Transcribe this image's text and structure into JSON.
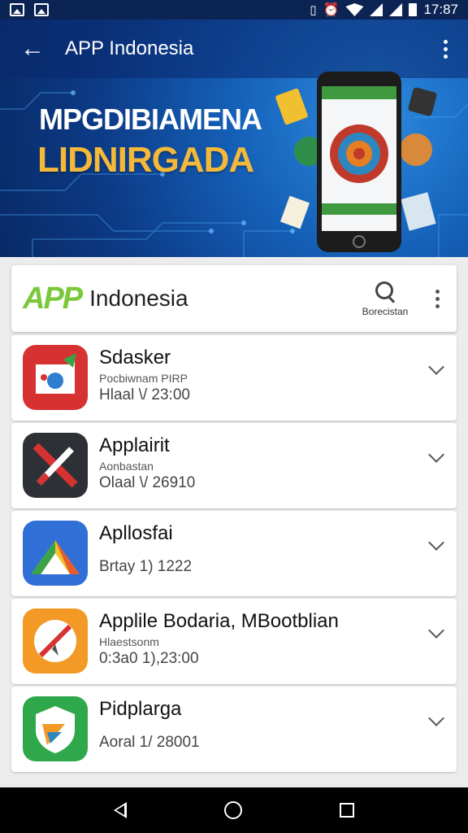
{
  "status_bar": {
    "time": "17:87"
  },
  "app_bar": {
    "title": "APP Indonesia"
  },
  "hero": {
    "line1": "MPGDIBIAMENA",
    "line2": "LIDNIRGADA"
  },
  "header": {
    "logo_mark": "APP",
    "logo_name": "Indonesia",
    "search_label": "Borecistan"
  },
  "list": {
    "items": [
      {
        "title": "Sdasker",
        "subtitle": "Pocbiwnam PIRP",
        "meta": "Hlaal \\/ 23:00",
        "icon": "red-chat-icon"
      },
      {
        "title": "Applairit",
        "subtitle": "Aonbastan",
        "meta": "Olaal \\/ 26910",
        "icon": "dark-x-icon"
      },
      {
        "title": "Apllosfai",
        "subtitle": "",
        "meta": "Brtay 1) 1222",
        "icon": "blue-triangle-icon"
      },
      {
        "title": "Applile Bodaria, MBootblian",
        "subtitle": "Hlaestsonm",
        "meta": "0:3a0 1),23:00",
        "icon": "orange-compass-icon"
      },
      {
        "title": "Pidplarga",
        "subtitle": "",
        "meta": "Aoral 1/ 28001",
        "icon": "green-shield-icon"
      }
    ]
  },
  "colors": {
    "status_bar": "#0c2454",
    "banner": "#1560b8",
    "accent_green": "#3aa34a",
    "banner_gold": "#f4b93a"
  }
}
